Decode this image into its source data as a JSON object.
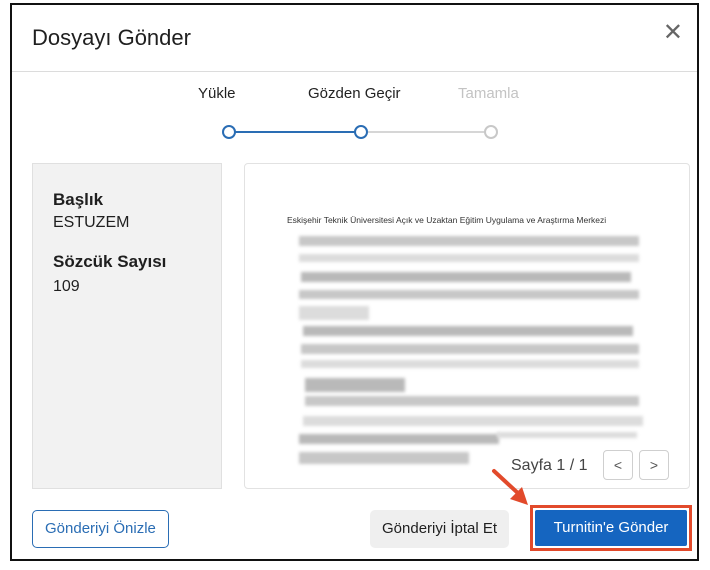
{
  "dialog": {
    "title": "Dosyayı Gönder",
    "close_glyph": "✕"
  },
  "stepper": {
    "steps": [
      {
        "label": "Yükle",
        "state": "done"
      },
      {
        "label": "Gözden Geçir",
        "state": "active"
      },
      {
        "label": "Tamamla",
        "state": "pending"
      }
    ]
  },
  "info": {
    "title_label": "Başlık",
    "title_value": "ESTUZEM",
    "wordcount_label": "Sözcük Sayısı",
    "wordcount_value": "109"
  },
  "preview": {
    "doc_heading": "Eskişehir Teknik Üniversitesi Açık ve Uzaktan Eğitim Uygulama ve Araştırma Merkezi",
    "pager_text": "Sayfa 1 / 1",
    "prev_glyph": "<",
    "next_glyph": ">"
  },
  "footer": {
    "preview_button": "Gönderiyi Önizle",
    "cancel_button": "Gönderiyi İptal Et",
    "submit_button": "Turnitin'e Gönder"
  },
  "colors": {
    "accent": "#1565c0",
    "step_active": "#2a6db4",
    "highlight": "#e24a2b"
  },
  "icons": [
    "close-icon",
    "arrow-annotation-icon",
    "chevron-left-icon",
    "chevron-right-icon"
  ]
}
